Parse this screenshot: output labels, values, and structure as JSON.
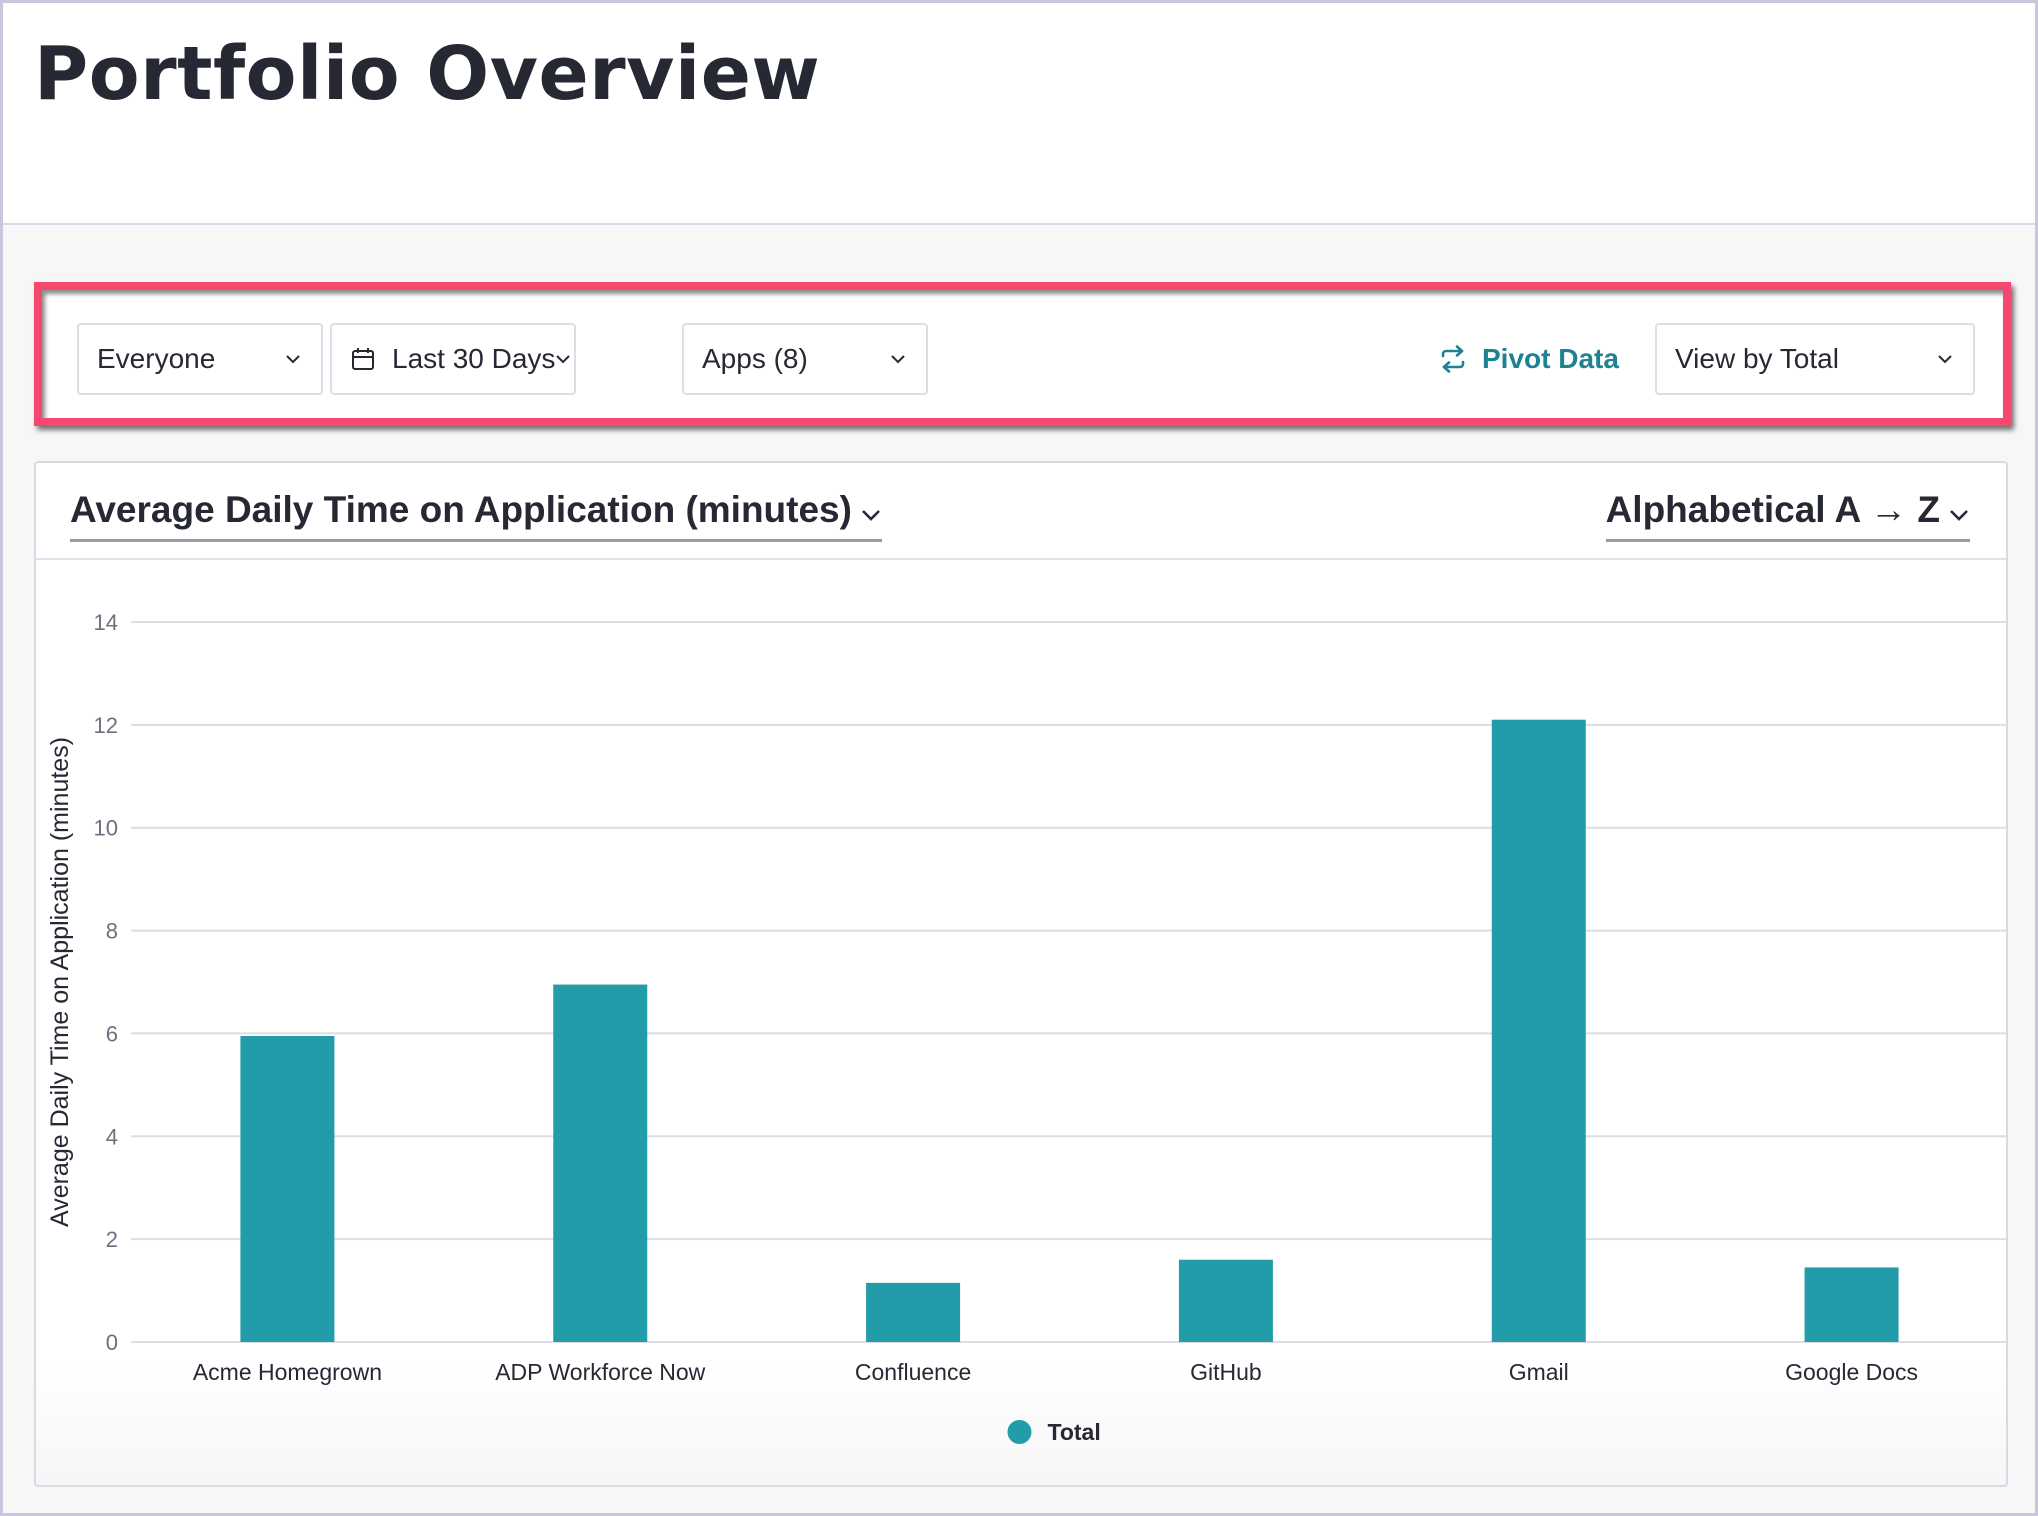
{
  "page": {
    "title": "Portfolio Overview"
  },
  "filters": {
    "audience": {
      "value": "Everyone"
    },
    "date_range": {
      "value": "Last 30 Days",
      "icon": "calendar-icon"
    },
    "apps": {
      "value": "Apps (8)"
    },
    "pivot": {
      "label": "Pivot Data",
      "icon": "arrows-swap-icon"
    },
    "view_by": {
      "value": "View by Total"
    }
  },
  "card": {
    "metric_select": "Average Daily Time on Application (minutes)",
    "sort_select": "Alphabetical A → Z"
  },
  "colors": {
    "bar": "#239ca9",
    "highlight_border": "#f5486f",
    "accent_link": "#1d8291"
  },
  "chart_data": {
    "type": "bar",
    "title": "Average Daily Time on Application (minutes)",
    "xlabel": "",
    "ylabel": "Average Daily Time on Application (minutes)",
    "categories": [
      "Acme Homegrown",
      "ADP Workforce Now",
      "Confluence",
      "GitHub",
      "Gmail",
      "Google Docs"
    ],
    "series": [
      {
        "name": "Total",
        "values": [
          5.95,
          6.95,
          1.15,
          1.6,
          12.1,
          1.45
        ]
      }
    ],
    "ylim": [
      0,
      14
    ],
    "yticks": [
      0,
      2,
      4,
      6,
      8,
      10,
      12,
      14
    ],
    "grid": true,
    "legend": {
      "position": "bottom-center",
      "entries": [
        "Total"
      ]
    }
  }
}
